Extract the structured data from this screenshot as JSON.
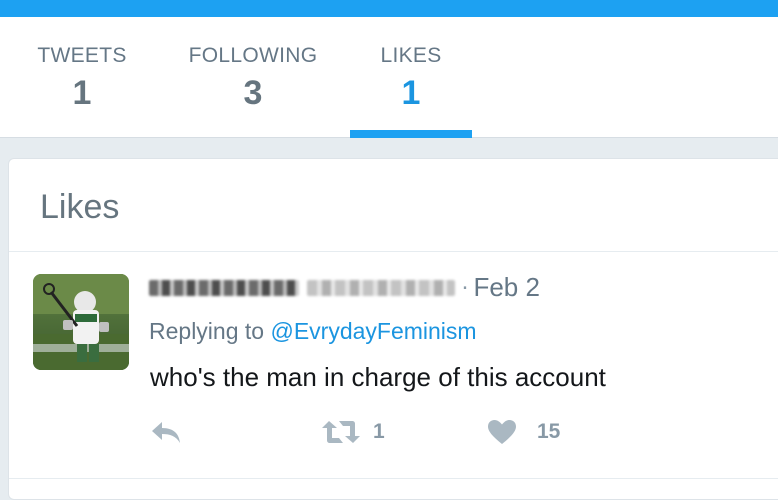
{
  "stats": [
    {
      "label": "TWEETS",
      "value": "1"
    },
    {
      "label": "FOLLOWING",
      "value": "3"
    },
    {
      "label": "LIKES",
      "value": "1"
    }
  ],
  "active_stat": "LIKES",
  "card": {
    "title": "Likes"
  },
  "tweet": {
    "author_name": "",
    "author_handle": "",
    "separator": "·",
    "time": "Feb 2",
    "reply_prefix": "Replying to ",
    "reply_handle": "@EvrydayFeminism",
    "text": "who's the man in charge of this account",
    "retweet_count": "1",
    "like_count": "15",
    "icons": {
      "reply": "reply-arrow-icon",
      "retweet": "retweet-icon",
      "like": "heart-icon"
    }
  },
  "colors": {
    "accent": "#1da1f2",
    "link": "#1b95e0",
    "muted": "#657786",
    "icon": "#aab8c2"
  }
}
